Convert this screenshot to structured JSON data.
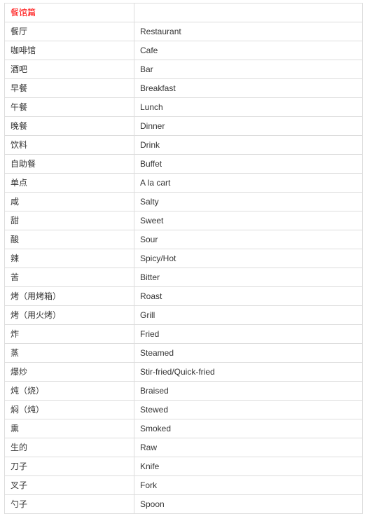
{
  "table": {
    "header": {
      "title": "餐馆篇"
    },
    "rows": [
      {
        "cn": "餐厅",
        "en": "Restaurant"
      },
      {
        "cn": "咖啡馆",
        "en": "Cafe"
      },
      {
        "cn": "酒吧",
        "en": "Bar"
      },
      {
        "cn": "早餐",
        "en": "Breakfast"
      },
      {
        "cn": "午餐",
        "en": "Lunch"
      },
      {
        "cn": "晚餐",
        "en": "Dinner"
      },
      {
        "cn": "饮料",
        "en": "Drink"
      },
      {
        "cn": "自助餐",
        "en": "Buffet"
      },
      {
        "cn": "单点",
        "en": "A la cart"
      },
      {
        "cn": "咸",
        "en": "Salty"
      },
      {
        "cn": "甜",
        "en": "Sweet"
      },
      {
        "cn": "酸",
        "en": "Sour"
      },
      {
        "cn": "辣",
        "en": "Spicy/Hot"
      },
      {
        "cn": "苦",
        "en": "Bitter"
      },
      {
        "cn": "烤（用烤箱）",
        "en": "Roast"
      },
      {
        "cn": "烤（用火烤）",
        "en": "Grill"
      },
      {
        "cn": "炸",
        "en": "Fried"
      },
      {
        "cn": "蒸",
        "en": "Steamed"
      },
      {
        "cn": "爆炒",
        "en": "Stir-fried/Quick-fried"
      },
      {
        "cn": "炖（烧）",
        "en": "Braised"
      },
      {
        "cn": "焖（炖）",
        "en": "Stewed"
      },
      {
        "cn": "熏",
        "en": "Smoked"
      },
      {
        "cn": "生的",
        "en": "Raw"
      },
      {
        "cn": "刀子",
        "en": "Knife"
      },
      {
        "cn": "叉子",
        "en": "Fork"
      },
      {
        "cn": "勺子",
        "en": "Spoon"
      }
    ]
  }
}
